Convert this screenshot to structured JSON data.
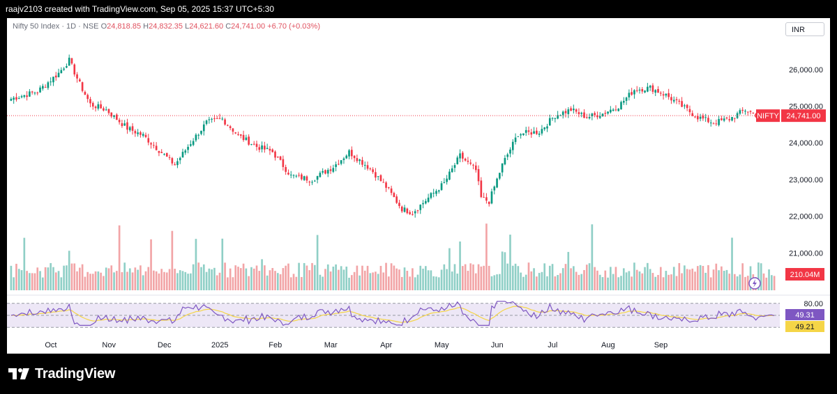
{
  "header": {
    "attribution": "raajv2103 created with TradingView.com, Sep 05, 2025 15:37 UTC+5:30"
  },
  "legend": {
    "title": "Nifty 50 Index · 1D · NSE",
    "open_label": "O",
    "open": "24,818.85",
    "high_label": "H",
    "high": "24,832.35",
    "low_label": "L",
    "low": "24,621.60",
    "close_label": "C",
    "close": "24,741.00",
    "change": "+6.70 (+0.03%)"
  },
  "currency": "INR",
  "brand": {
    "name": "TradingView"
  },
  "colors": {
    "up": "#089981",
    "down": "#f23645",
    "vol_up": "#8fcfc6",
    "vol_down": "#f2a4a6",
    "rsi_line": "#7e57c2",
    "rsi_ma": "#f5d547",
    "rsi_band": "#ede7f6",
    "price_badge": "#f23645"
  },
  "chart_data": {
    "type": "candlestick",
    "price_ticks": [
      "26,000.00",
      "25,000.00",
      "24,000.00",
      "23,000.00",
      "22,000.00",
      "21,000.00"
    ],
    "price_tick_values": [
      26000,
      25000,
      24000,
      23000,
      22000,
      21000
    ],
    "ylim": [
      20000,
      27400
    ],
    "x_labels": [
      "Oct",
      "Nov",
      "Dec",
      "2025",
      "Feb",
      "Mar",
      "Apr",
      "May",
      "Jun",
      "Jul",
      "Aug",
      "Sep"
    ],
    "last_price": {
      "symbol": "NIFTY",
      "value": "24,741.00",
      "price": 24741
    },
    "volume_label": "210.04M",
    "rsi": {
      "upper": "80.00",
      "value": "49.31",
      "ma_value": "49.21",
      "upper_level": 80,
      "mid_level": 50,
      "lower_level": 20
    },
    "waypoints": [
      [
        0,
        25200
      ],
      [
        10,
        25400
      ],
      [
        18,
        25900
      ],
      [
        22,
        26250
      ],
      [
        26,
        25600
      ],
      [
        30,
        25050
      ],
      [
        36,
        24900
      ],
      [
        44,
        24400
      ],
      [
        50,
        24200
      ],
      [
        56,
        23800
      ],
      [
        62,
        23400
      ],
      [
        68,
        24000
      ],
      [
        74,
        24550
      ],
      [
        80,
        24650
      ],
      [
        86,
        24200
      ],
      [
        93,
        23900
      ],
      [
        99,
        23750
      ],
      [
        106,
        23100
      ],
      [
        114,
        23000
      ],
      [
        122,
        23350
      ],
      [
        128,
        23750
      ],
      [
        136,
        23300
      ],
      [
        142,
        22800
      ],
      [
        148,
        22200
      ],
      [
        152,
        22100
      ],
      [
        158,
        22500
      ],
      [
        164,
        22900
      ],
      [
        170,
        23650
      ],
      [
        176,
        23250
      ],
      [
        178,
        22500
      ],
      [
        181,
        22400
      ],
      [
        186,
        23400
      ],
      [
        192,
        24250
      ],
      [
        200,
        24300
      ],
      [
        206,
        24750
      ],
      [
        212,
        24900
      ],
      [
        218,
        24700
      ],
      [
        224,
        24800
      ],
      [
        230,
        25000
      ],
      [
        236,
        25450
      ],
      [
        242,
        25500
      ],
      [
        248,
        25300
      ],
      [
        254,
        25000
      ],
      [
        260,
        24700
      ],
      [
        266,
        24550
      ],
      [
        272,
        24650
      ],
      [
        278,
        24900
      ],
      [
        284,
        24700
      ],
      [
        289,
        24741
      ]
    ]
  }
}
